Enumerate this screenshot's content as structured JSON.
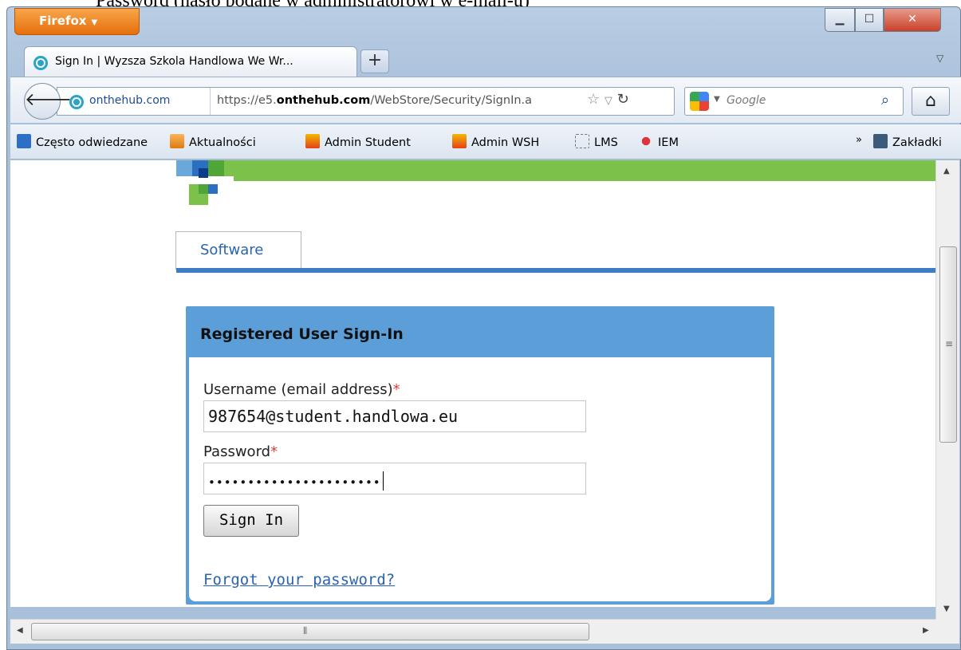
{
  "caption": "Password (hasło podane w administratorowi w e-mail-u)",
  "browser": {
    "menu_button": "Firefox",
    "tab_title": "Sign In | Wyzsza Szkola Handlowa We Wr...",
    "new_tab": "+",
    "identity": "onthehub.com",
    "url_prefix": "https://e5.",
    "url_domain": "onthehub.com",
    "url_path": "/WebStore/Security/SignIn.a",
    "search_engine": "Google"
  },
  "bookmarks": [
    {
      "label": "Często odwiedzane",
      "icon": "recent-icon"
    },
    {
      "label": "Aktualności",
      "icon": "rss-icon"
    },
    {
      "label": "Admin Student",
      "icon": "pma-icon"
    },
    {
      "label": "Admin WSH",
      "icon": "pma-icon"
    },
    {
      "label": "LMS",
      "icon": "folder-icon"
    },
    {
      "label": "IEM",
      "icon": "iem-icon"
    }
  ],
  "bookmarks_menu": "Zakładki",
  "page": {
    "tab": "Software",
    "panel_title": "Registered User Sign-In",
    "username_label": "Username (email address)",
    "username_value": "987654@student.handlowa.eu",
    "password_label": "Password",
    "password_mask": "••••••••••••••••••••••",
    "required_mark": "*",
    "sign_in": "Sign In",
    "forgot": "Forgot your password?"
  },
  "colors": {
    "panel": "#5c9fd8",
    "link": "#2a64b0",
    "banner": "#7cc24a",
    "firefox": "#e66f0c"
  }
}
